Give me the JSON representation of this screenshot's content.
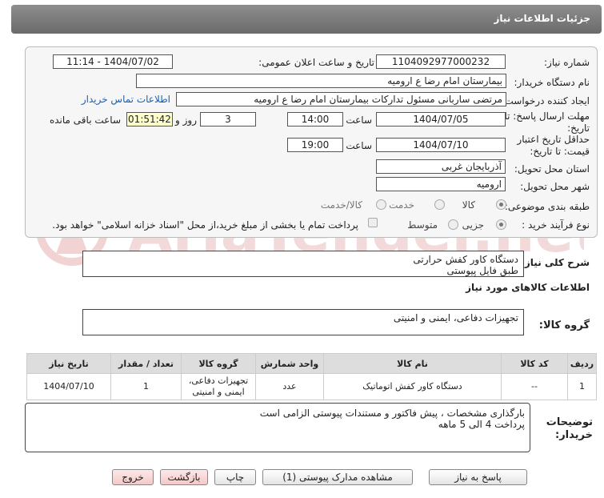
{
  "header": {
    "title": "جزئیات اطلاعات نیاز"
  },
  "watermark": {
    "text": "AriaTender.net"
  },
  "fields": {
    "need_number_label": "شماره نیاز:",
    "need_number": "1104092977000232",
    "announce_label": "تاریخ و ساعت اعلان عمومی:",
    "announce_value": "1404/07/02 - 11:14",
    "buyer_label": "نام دستگاه خریدار:",
    "buyer_value": "بیمارستان امام رضا  ع  ارومیه",
    "requester_label": "ایجاد کننده درخواست:",
    "requester_value": "مرتضی ساربانی مسئول تدارکات بیمارستان امام رضا  ع  ارومیه",
    "contact_link": "اطلاعات تماس خریدار",
    "deadline_label": "مهلت ارسال پاسخ: تا تاریخ:",
    "deadline_date": "1404/07/05",
    "time_label": "ساعت",
    "deadline_time": "14:00",
    "days_value": "3",
    "days_label": "روز و",
    "remaining_value": "01:51:42",
    "remaining_label": "ساعت باقی مانده",
    "validity_label": "حداقل تاریخ اعتبار قیمت: تا تاریخ:",
    "validity_date": "1404/07/10",
    "validity_time": "19:00",
    "province_label": "استان محل تحویل:",
    "province_value": "آذربایجان غربی",
    "city_label": "شهر محل تحویل:",
    "city_value": "ارومیه",
    "category_label": "طبقه بندی موضوعی:",
    "category_options": [
      "کالا",
      "خدمت",
      "کالا/خدمت"
    ],
    "process_label": "نوع فرآیند خرید :",
    "process_options": [
      "جزیی",
      "متوسط"
    ],
    "payment_note": "پرداخت تمام یا بخشی از مبلغ خرید،از محل \"اسناد خزانه اسلامی\" خواهد بود."
  },
  "summary": {
    "label": "شرح کلی نیاز:",
    "lines": [
      "دستگاه کاور کفش حرارتی",
      "طبق فایل پیوستی"
    ]
  },
  "goods_info_title": "اطلاعات کالاهای مورد نیاز",
  "goods_group": {
    "label": "گروه کالا:",
    "value": "تجهیزات دفاعی، ایمنی و امنیتی"
  },
  "table": {
    "headers": [
      "ردیف",
      "کد کالا",
      "نام کالا",
      "واحد شمارش",
      "گروه کالا",
      "تعداد / مقدار",
      "تاریخ نیاز"
    ],
    "rows": [
      {
        "row": "1",
        "code": "--",
        "name": "دستگاه کاور کفش اتوماتیک",
        "unit": "عدد",
        "group_line1": "تجهیزات دفاعی،",
        "group_line2": "ایمنی و امنیتی",
        "qty": "1",
        "date": "1404/07/10"
      }
    ]
  },
  "buyer_notes": {
    "label_line1": "توضیحات",
    "label_line2": "خریدار:",
    "lines": [
      "بارگذاری مشخصات ، پیش فاکتور و مستندات پیوستی الزامی است",
      "پرداخت 4 الی 5 ماهه"
    ]
  },
  "buttons": {
    "reply": "پاسخ به نیاز",
    "attachments": "مشاهده مدارک پیوستی (1)",
    "print": "چاپ",
    "back": "بازگشت",
    "exit": "خروج"
  }
}
